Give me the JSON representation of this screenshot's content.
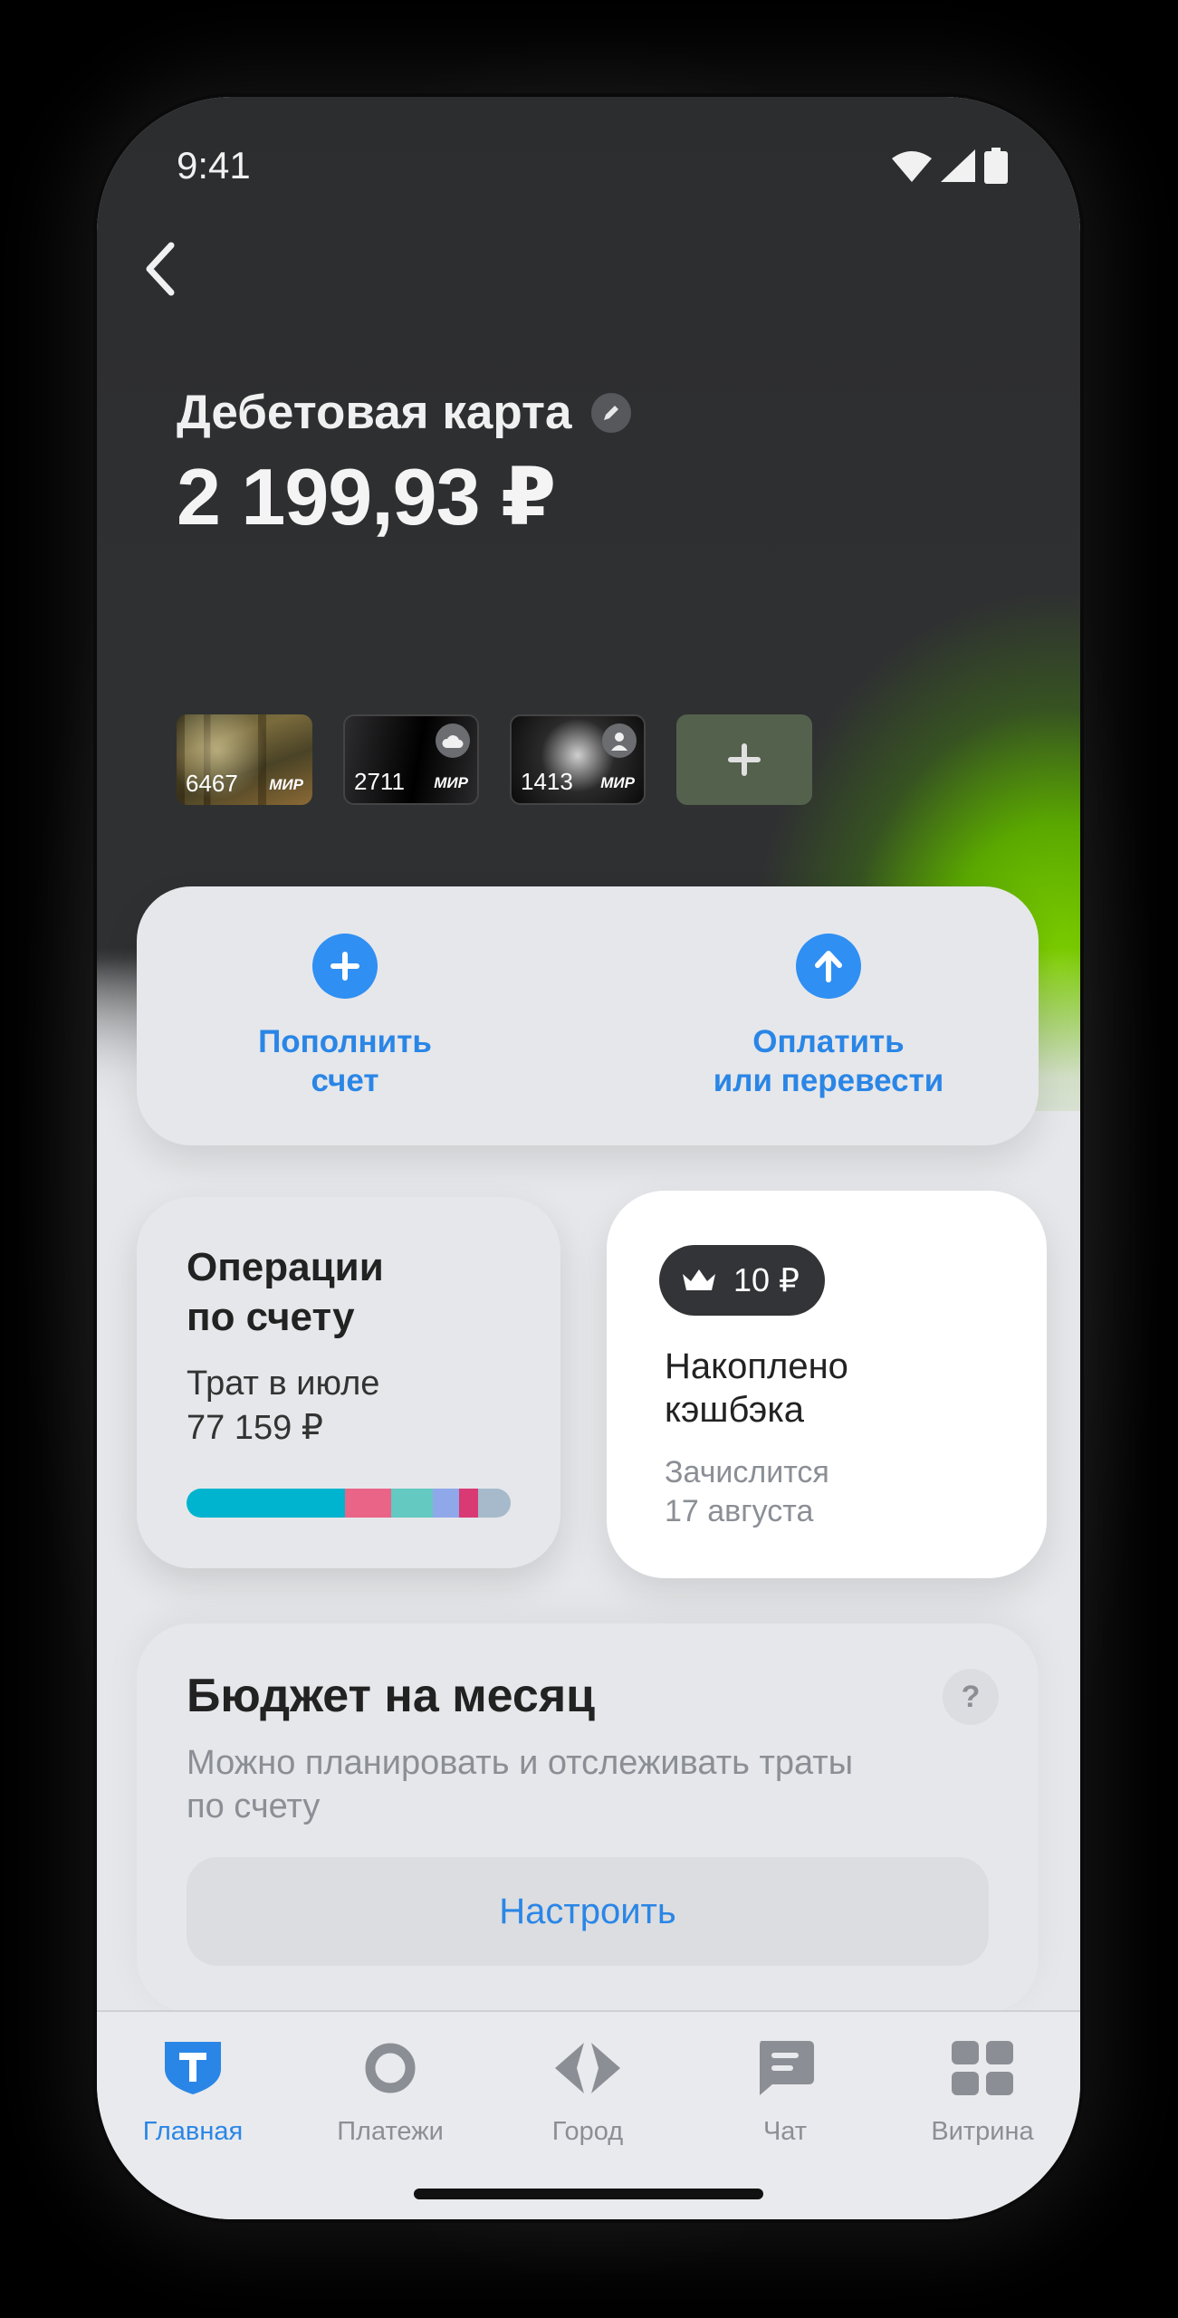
{
  "status": {
    "time": "9:41"
  },
  "account": {
    "title": "Дебетовая карта",
    "balance": "2 199,93 ₽"
  },
  "cards": [
    {
      "last4": "6467",
      "network": "МИР",
      "style": "forest"
    },
    {
      "last4": "2711",
      "network": "МИР",
      "style": "dark",
      "badge": "cloud-icon"
    },
    {
      "last4": "1413",
      "network": "МИР",
      "style": "cat",
      "badge": "person-icon"
    }
  ],
  "actions": {
    "topup": {
      "label": "Пополнить\nсчет",
      "icon": "plus-icon"
    },
    "pay": {
      "label": "Оплатить\nили перевести",
      "icon": "arrow-up-icon"
    }
  },
  "operations": {
    "title": "Операции\nпо счету",
    "subtitle": "Трат в июле\n77 159 ₽",
    "spend_bar": [
      {
        "fraction": 0.49,
        "color": "#00b4cf"
      },
      {
        "fraction": 0.14,
        "color": "#e96487"
      },
      {
        "fraction": 0.13,
        "color": "#63c9c1"
      },
      {
        "fraction": 0.08,
        "color": "#8fa8ea"
      },
      {
        "fraction": 0.06,
        "color": "#d93a73"
      },
      {
        "fraction": 0.1,
        "color": "#a6bacb"
      }
    ]
  },
  "cashback": {
    "amount": "10 ₽",
    "title": "Накоплено\nкэшбэка",
    "subtitle": "Зачислится\n17 августа"
  },
  "budget": {
    "title": "Бюджет на месяц",
    "description": "Можно планировать и отслеживать траты по счету",
    "button": "Настроить",
    "help": "?"
  },
  "tabs": [
    {
      "label": "Главная",
      "icon": "shield-t-icon",
      "active": true
    },
    {
      "label": "Платежи",
      "icon": "ring-icon",
      "active": false
    },
    {
      "label": "Город",
      "icon": "diamond-icon",
      "active": false
    },
    {
      "label": "Чат",
      "icon": "chat-icon",
      "active": false
    },
    {
      "label": "Витрина",
      "icon": "grid-icon",
      "active": false
    }
  ],
  "colors": {
    "accent": "#2a86e6",
    "green_glow": "#7fd000"
  }
}
